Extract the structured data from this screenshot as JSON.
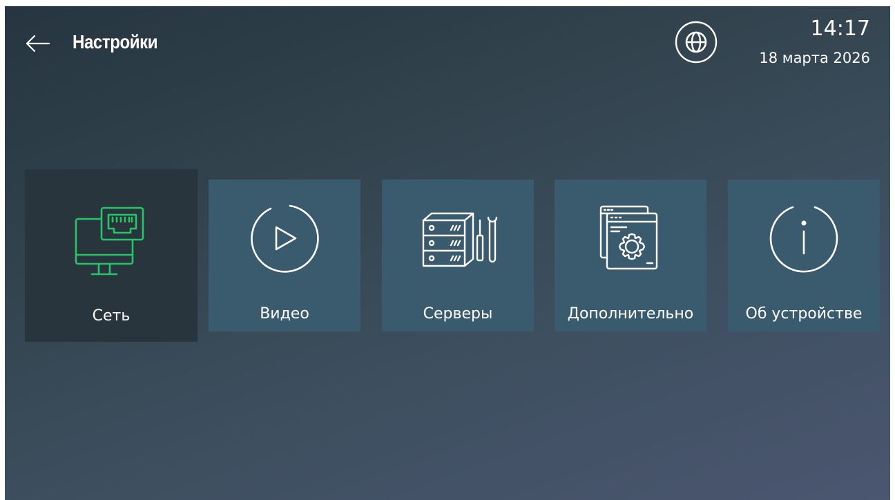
{
  "header": {
    "title": "Настройки",
    "back_icon": "arrow-left-icon",
    "language_icon": "globe-icon",
    "time": "14:17",
    "date": "18 марта 2026"
  },
  "menu": {
    "selected_index": 0,
    "accent_color": "#27c46a",
    "tile_color": "#3a5a6e",
    "selected_tile_color": "#28353d",
    "items": [
      {
        "label": "Сеть",
        "icon": "network-monitor-icon"
      },
      {
        "label": "Видео",
        "icon": "play-circle-icon"
      },
      {
        "label": "Серверы",
        "icon": "server-tools-icon"
      },
      {
        "label": "Дополнительно",
        "icon": "settings-window-icon"
      },
      {
        "label": "Об устройстве",
        "icon": "info-circle-icon"
      }
    ]
  }
}
